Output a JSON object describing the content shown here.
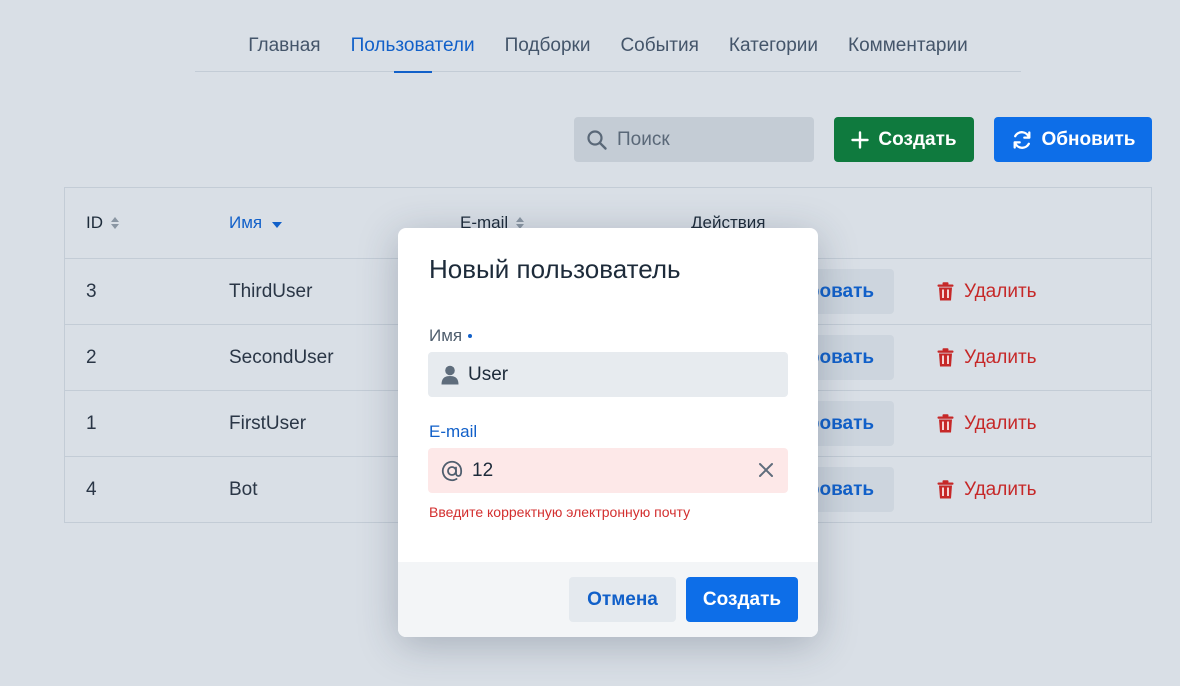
{
  "nav": {
    "tabs": [
      {
        "label": "Главная"
      },
      {
        "label": "Пользователи",
        "active": true
      },
      {
        "label": "Подборки"
      },
      {
        "label": "События"
      },
      {
        "label": "Категории"
      },
      {
        "label": "Комментарии"
      }
    ]
  },
  "toolbar": {
    "search_placeholder": "Поиск",
    "create_label": "Создать",
    "refresh_label": "Обновить"
  },
  "table": {
    "headers": {
      "id": "ID",
      "name": "Имя",
      "email": "E-mail",
      "actions": "Действия"
    },
    "sorted_column": "name",
    "rows": [
      {
        "id": "3",
        "name": "ThirdUser",
        "edit_label": "ровать",
        "delete_label": "Удалить"
      },
      {
        "id": "2",
        "name": "SecondUser",
        "edit_label": "ровать",
        "delete_label": "Удалить"
      },
      {
        "id": "1",
        "name": "FirstUser",
        "edit_label": "ровать",
        "delete_label": "Удалить"
      },
      {
        "id": "4",
        "name": "Bot",
        "edit_label": "ровать",
        "delete_label": "Удалить"
      }
    ]
  },
  "modal": {
    "title": "Новый пользователь",
    "name_label": "Имя",
    "name_value": "User",
    "email_label": "E-mail",
    "email_value": "12",
    "email_error": "Введите корректную электронную почту",
    "cancel_label": "Отмена",
    "submit_label": "Создать"
  },
  "colors": {
    "primary": "#0d6ee8",
    "success": "#0f7a3e",
    "danger": "#c62828",
    "error_bg": "#fde8e8"
  },
  "icons": {
    "search": "search-icon",
    "create": "plus-icon",
    "refresh": "refresh-icon",
    "sort": "sort-icon",
    "sort_desc": "caret-down-icon",
    "delete": "trash-icon",
    "user": "user-icon",
    "at": "at-icon",
    "clear": "close-icon"
  }
}
